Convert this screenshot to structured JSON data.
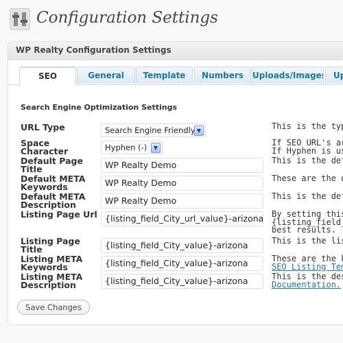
{
  "page": {
    "title": "Configuration Settings",
    "icon": "settings-icon"
  },
  "panel": {
    "title": "WP Realty Configuration Settings"
  },
  "tabs": [
    "SEO",
    "General",
    "Template",
    "Numbers",
    "Uploads/Images",
    "Up"
  ],
  "active_tab": "SEO",
  "section_heading": "Search Engine Optimization Settings",
  "fields": {
    "url_type": {
      "label": "URL Type",
      "value": "Search Engine Friendly",
      "desc": "This is the type"
    },
    "space_character": {
      "label_1": "Space",
      "label_2": "Character",
      "value": "Hyphen (-)",
      "desc_1": "If SEO URL's are",
      "desc_2": "If Hyphen is use"
    },
    "default_page_title": {
      "label_1": "Default Page",
      "label_2": "Title",
      "value": "WP Realty Demo",
      "desc": "This is the defau"
    },
    "default_meta_keywords": {
      "label_1": "Default META",
      "label_2": "Keywords",
      "value": "WP Realty Demo",
      "desc": "These are the de"
    },
    "default_meta_description": {
      "label_1": "Default META",
      "label_2": "Description",
      "value": "WP Realty Demo",
      "desc": "This is the defau"
    },
    "listing_page_url": {
      "label": "Listing Page Url",
      "value": "{listing_field_City_url_value}-arizona",
      "desc_1": "By setting this c",
      "desc_2": "{listing_field_ad",
      "desc_3": "best results."
    },
    "listing_page_title": {
      "label_1": "Listing Page",
      "label_2": "Title",
      "value": "{listing_field_City_value}-arizona",
      "desc": "This is the listin"
    },
    "listing_meta_keywords": {
      "label_1": "Listing META",
      "label_2": "Keywords",
      "value": "{listing_field_City_value}-arizona",
      "desc_1": "These are the ke",
      "desc_2": "SEO Listing Tem"
    },
    "listing_meta_description": {
      "label_1": "Listing META",
      "label_2": "Description",
      "value": "{listing_field_City_value}-arizona",
      "desc_1": "This is the desc",
      "desc_2": "Documentation."
    }
  },
  "buttons": {
    "save": "Save Changes"
  },
  "colors": {
    "link": "#21759b",
    "tab_border": "#c6d9e9",
    "select_arrow": "#a9c1f5"
  }
}
